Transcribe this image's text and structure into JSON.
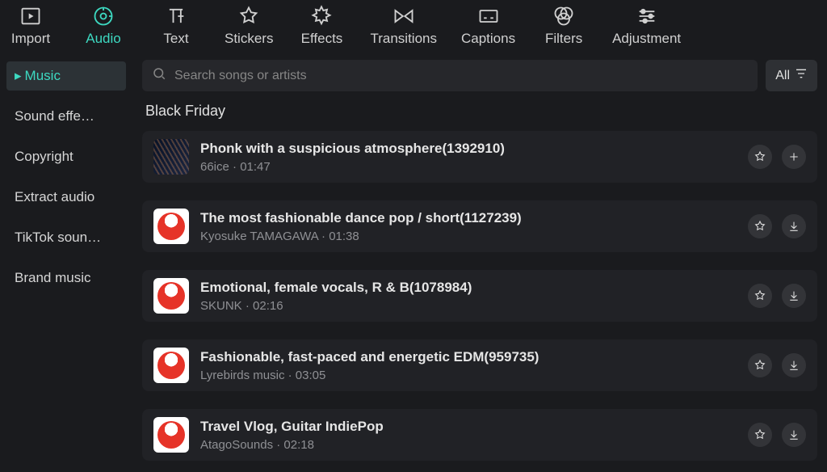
{
  "top_nav": [
    {
      "label": "Import"
    },
    {
      "label": "Audio",
      "active": true
    },
    {
      "label": "Text"
    },
    {
      "label": "Stickers"
    },
    {
      "label": "Effects"
    },
    {
      "label": "Transitions"
    },
    {
      "label": "Captions"
    },
    {
      "label": "Filters"
    },
    {
      "label": "Adjustment"
    }
  ],
  "sidebar": [
    {
      "label": "Music",
      "active": true
    },
    {
      "label": "Sound effe…"
    },
    {
      "label": "Copyright"
    },
    {
      "label": "Extract audio"
    },
    {
      "label": "TikTok soun…"
    },
    {
      "label": "Brand music"
    }
  ],
  "search": {
    "placeholder": "Search songs or artists",
    "all_label": "All"
  },
  "section_title": "Black Friday",
  "tracks": [
    {
      "title": "Phonk with a suspicious atmosphere(1392910)",
      "artist": "66ice",
      "duration": "01:47",
      "art": "dark",
      "action": "add"
    },
    {
      "title": "The most fashionable dance pop / short(1127239)",
      "artist": "Kyosuke TAMAGAWA",
      "duration": "01:38",
      "art": "red",
      "action": "download"
    },
    {
      "title": "Emotional, female vocals, R & B(1078984)",
      "artist": "SKUNK",
      "duration": "02:16",
      "art": "red",
      "action": "download"
    },
    {
      "title": "Fashionable, fast-paced and energetic EDM(959735)",
      "artist": "Lyrebirds music",
      "duration": "03:05",
      "art": "red",
      "action": "download"
    },
    {
      "title": "Travel Vlog, Guitar IndiePop",
      "artist": "AtagoSounds",
      "duration": "02:18",
      "art": "red",
      "action": "download"
    }
  ]
}
